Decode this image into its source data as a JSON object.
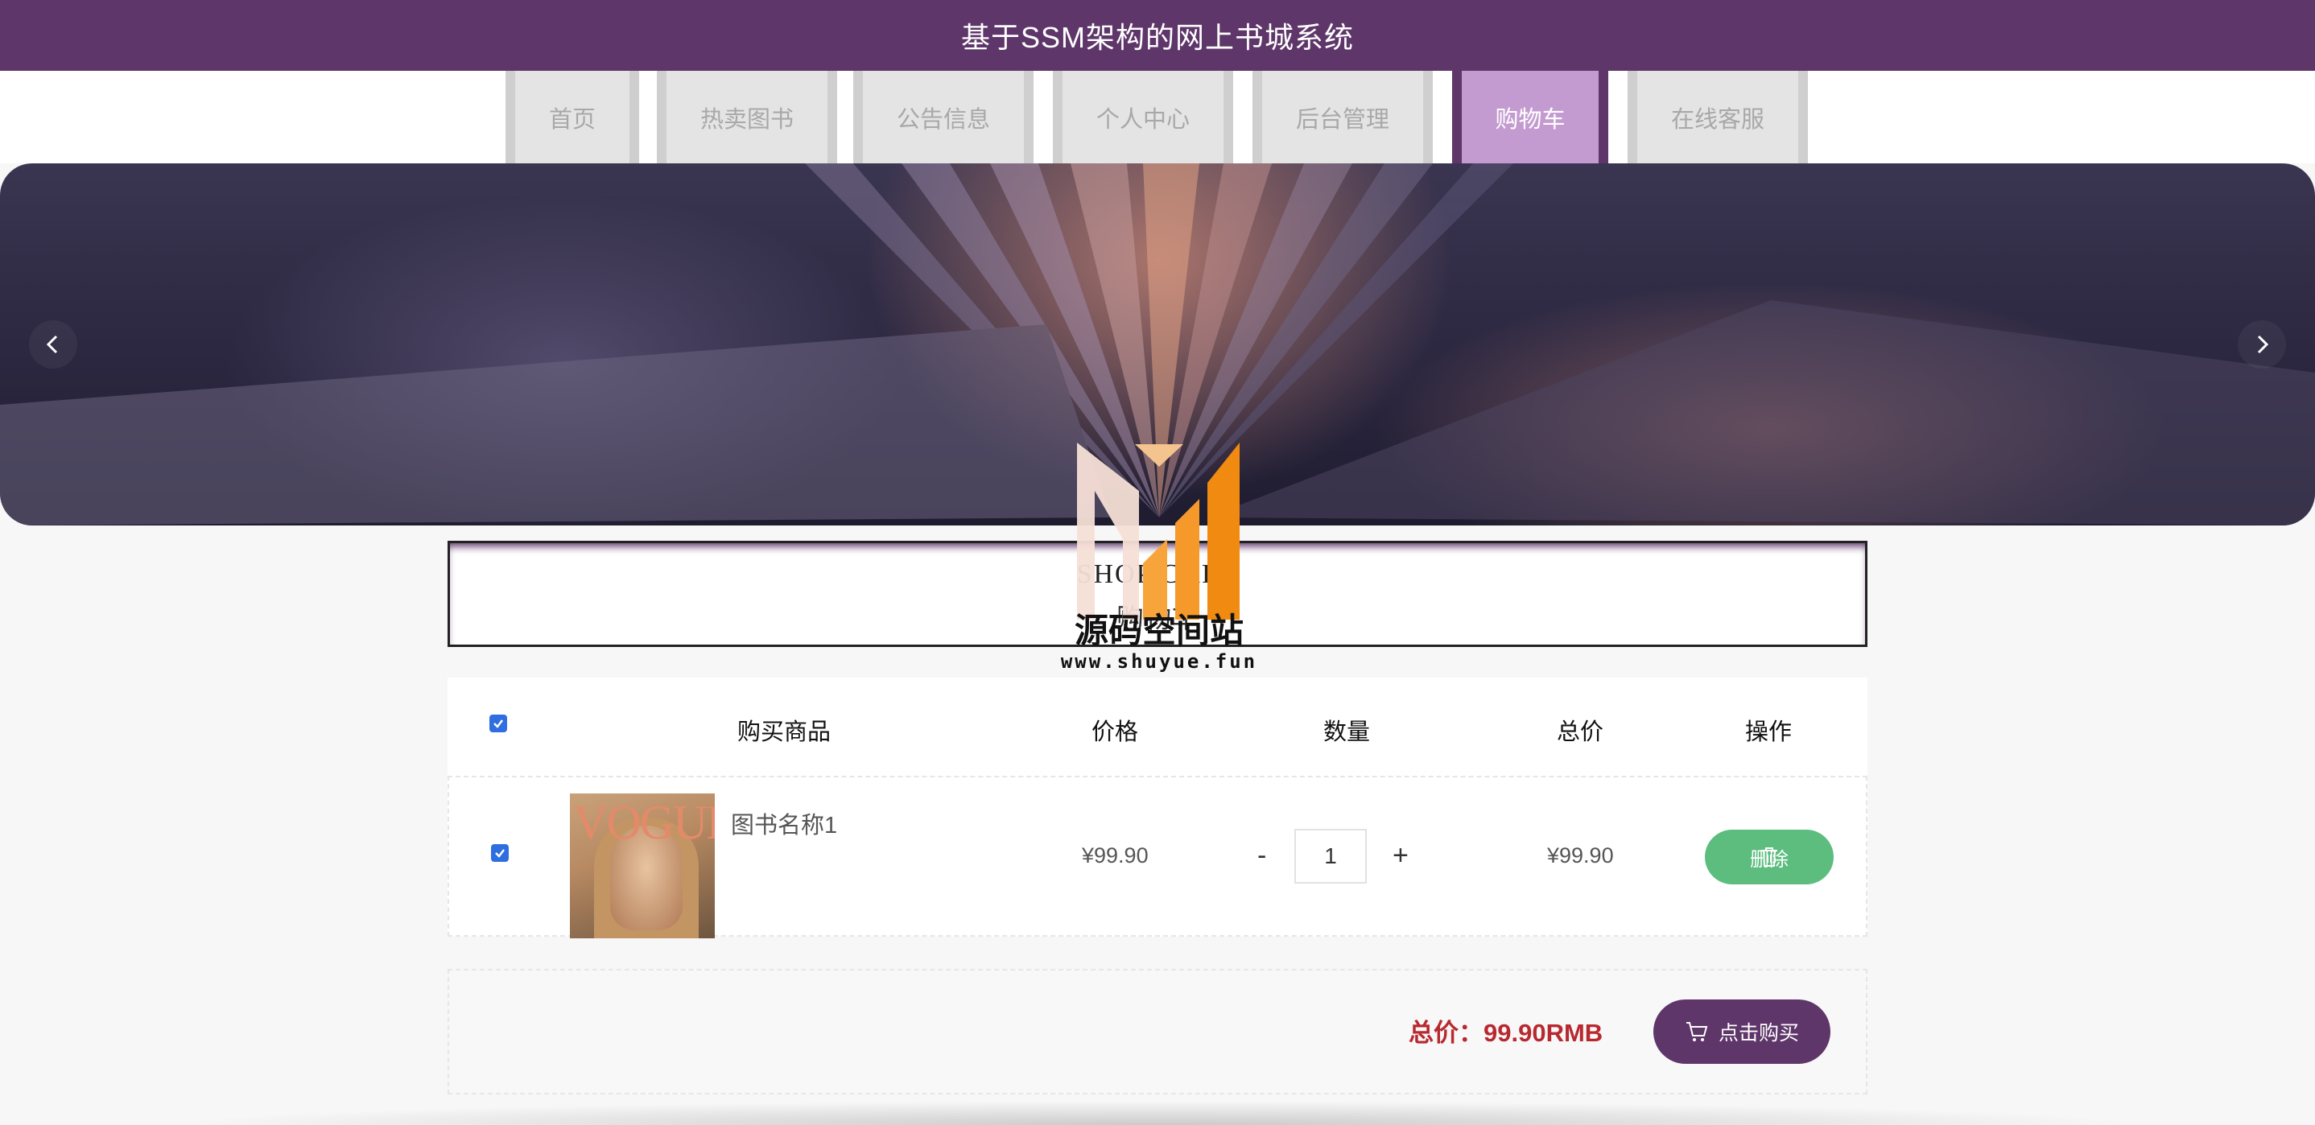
{
  "header": {
    "title": "基于SSM架构的网上书城系统"
  },
  "nav": {
    "tabs": [
      {
        "label": "首页",
        "active": false
      },
      {
        "label": "热卖图书",
        "active": false
      },
      {
        "label": "公告信息",
        "active": false
      },
      {
        "label": "个人中心",
        "active": false
      },
      {
        "label": "后台管理",
        "active": false
      },
      {
        "label": "购物车",
        "active": true
      },
      {
        "label": "在线客服",
        "active": false
      }
    ]
  },
  "banner": {
    "prev_icon": "chevron-left-icon",
    "next_icon": "chevron-right-icon"
  },
  "section": {
    "title_en": "SHOP CART",
    "title_zh": "购物车"
  },
  "watermark": {
    "name": "源码空间站",
    "url": "www.shuyue.fun"
  },
  "cart": {
    "headers": {
      "product": "购买商品",
      "price": "价格",
      "quantity": "数量",
      "total": "总价",
      "action": "操作"
    },
    "select_all_checked": true,
    "items": [
      {
        "checked": true,
        "cover_title": "VOGUE",
        "name": "图书名称1",
        "price": "¥99.90",
        "qty_minus": "-",
        "quantity": "1",
        "qty_plus": "+",
        "total": "¥99.90",
        "delete_label": "删除"
      }
    ]
  },
  "summary": {
    "total_label": "总价：99.90RMB",
    "buy_label": "点击购买"
  },
  "colors": {
    "brand": "#5e3669",
    "active_tab": "#c49bd1",
    "delete": "#5cbd7f",
    "price_red": "#b8292f",
    "checkbox": "#2f6ee0"
  }
}
